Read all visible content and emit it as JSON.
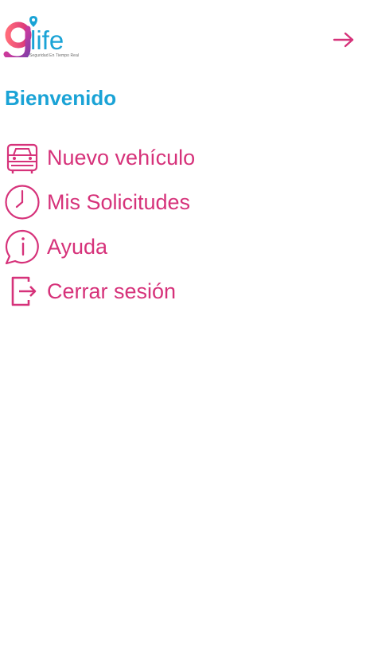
{
  "app": {
    "logo_text": "life",
    "logo_tagline": "Seguridad En Tiempo Real"
  },
  "header": {
    "exit_icon": "arrow-right-icon"
  },
  "welcome": {
    "title": "Bienvenido"
  },
  "menu": {
    "items": [
      {
        "label": "Nuevo vehículo",
        "icon": "car-icon"
      },
      {
        "label": "Mis Solicitudes",
        "icon": "clock-icon"
      },
      {
        "label": "Ayuda",
        "icon": "info-bubble-icon"
      },
      {
        "label": "Cerrar sesión",
        "icon": "logout-icon"
      }
    ]
  },
  "colors": {
    "brand_pink": "#d6327a",
    "brand_blue": "#1aa3d6",
    "background": "#ffffff"
  }
}
